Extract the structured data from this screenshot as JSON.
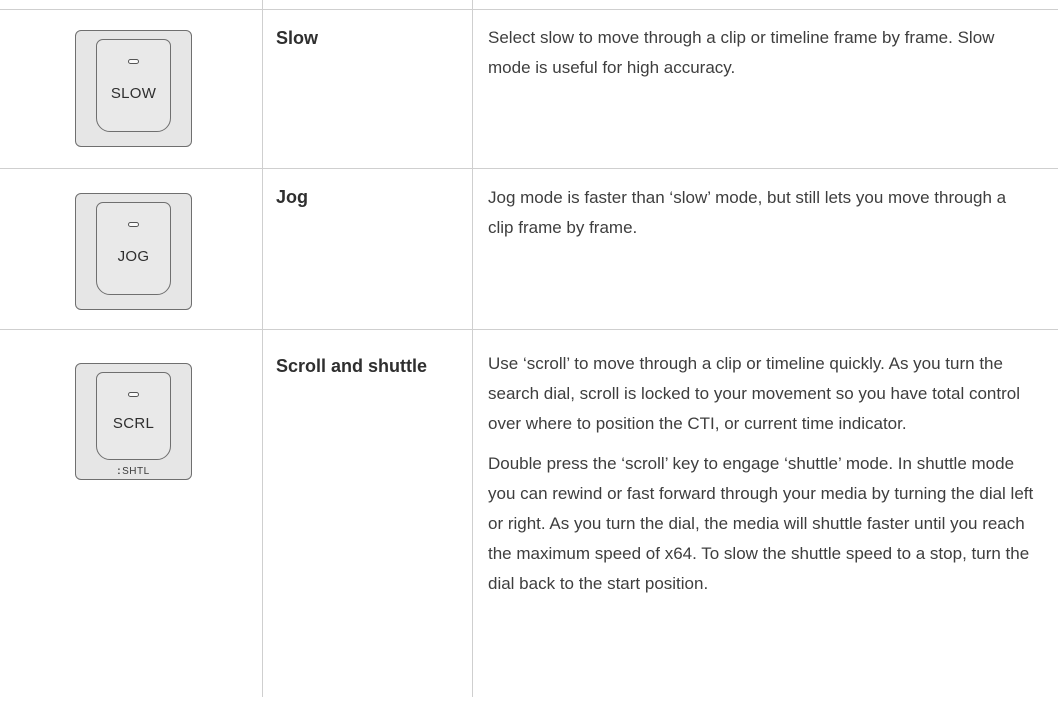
{
  "rows": [
    {
      "key_label": "SLOW",
      "key_sublabel": "",
      "title": "Slow",
      "paragraphs": [
        "Select slow to move through a clip or timeline frame by frame. Slow mode is useful for high accuracy."
      ]
    },
    {
      "key_label": "JOG",
      "key_sublabel": "",
      "title": "Jog",
      "paragraphs": [
        "Jog mode is faster than ‘slow’ mode, but still lets you move through a clip frame by frame."
      ]
    },
    {
      "key_label": "SCRL",
      "key_sublabel": "SHTL",
      "title": "Scroll and shuttle",
      "paragraphs": [
        "Use ‘scroll’ to move through a clip or timeline quickly. As you turn the search dial, scroll is locked to your movement so you have total control over where to position the CTI, or current time indicator.",
        "Double press the ‘scroll’ key to engage ‘shuttle’ mode. In shuttle mode you can rewind or fast forward through your media by turning the dial left or right. As you turn the dial, the media will shuttle faster until you reach the maximum speed of x64. To slow the shuttle speed to a stop, turn the dial back to the start position."
      ]
    }
  ]
}
